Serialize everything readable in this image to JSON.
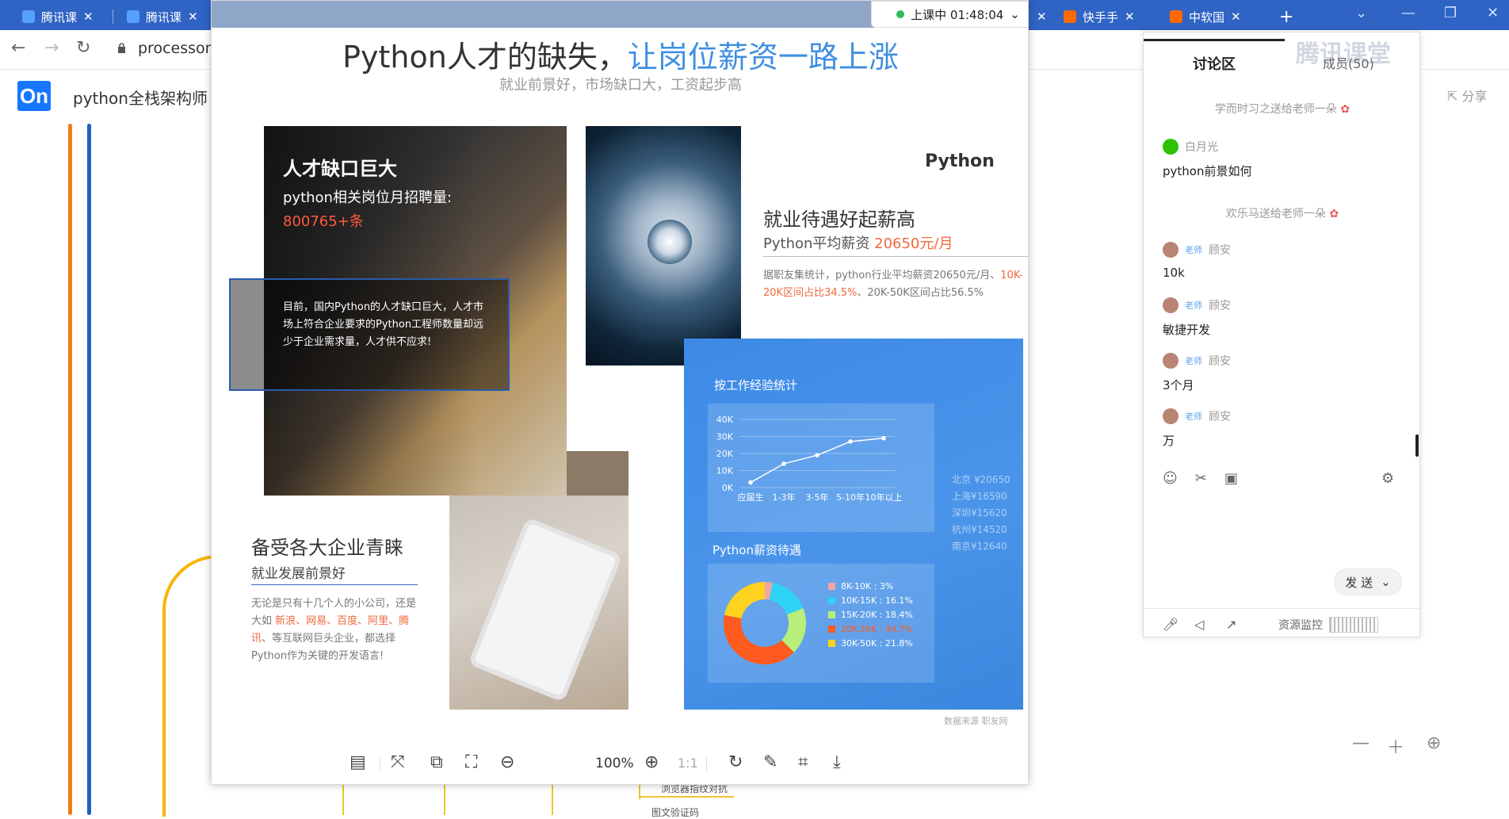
{
  "browser": {
    "tabs": [
      {
        "label": "腾讯课",
        "color": "#2f63c4"
      },
      {
        "label": "腾讯课",
        "color": "#2f63c4"
      },
      {
        "label": "快手手",
        "color": "#ff6a00"
      },
      {
        "label": "中软国",
        "color": "#ff6a00"
      }
    ],
    "url": "processon.",
    "new_tab": "+"
  },
  "app": {
    "logo": "On",
    "title": "python全栈架构师",
    "share": "分享"
  },
  "mindmap": {
    "nodes": [
      "浏览器指纹对抗",
      "图文验证码"
    ]
  },
  "viewer": {
    "timer": "上课中 01:48:04",
    "zoom": "100%"
  },
  "slide": {
    "title_a": "Python人才的缺失，",
    "title_b": "让岗位薪资一路上涨",
    "subtitle": "就业前景好，市场缺口大，工资起步高",
    "gap": {
      "heading": "人才缺口巨大",
      "line": "python相关岗位月招聘量:",
      "number": "800765+条",
      "callout": "目前，国内Python的人才缺口巨大，人才市场上符合企业要求的Python工程师数量却远少于企业需求量，人才供不应求!"
    },
    "job": {
      "python_label": "Python",
      "heading": "就业待遇好起薪高",
      "salary_prefix": "Python平均薪资 ",
      "salary_value": "20650元/月",
      "para_a": "据职友集统计，python行业平均薪资20650元/月、",
      "para_hl": "10K-20K区间占比34.5%",
      "para_b": "、20K-50K区间占比56.5%"
    },
    "panel": {
      "line_title": "按工作经验统计",
      "donut_title": "Python薪资待遇",
      "cities": [
        "北京 ¥20650",
        "上海¥16590",
        "深圳¥15620",
        "杭州¥14520",
        "南京¥12640"
      ],
      "source": "数据来源 职友网"
    },
    "enterprise": {
      "heading": "备受各大企业青睐",
      "sub": "就业发展前景好",
      "para_a": "无论是只有十几个人的小公司，还是大如 ",
      "para_hl": "新浪、网易、百度、阿里、腾讯",
      "para_b": "、等互联网巨头企业，都选择Python作为关键的开发语言!"
    }
  },
  "chart_data": [
    {
      "type": "line",
      "title": "按工作经验统计",
      "categories": [
        "应届生",
        "1-3年",
        "3-5年",
        "5-10年",
        "10年以上"
      ],
      "yticks": [
        "0K",
        "10K",
        "20K",
        "30K",
        "40K"
      ],
      "values": [
        3,
        14,
        19,
        27,
        29
      ],
      "ylim": [
        0,
        40
      ],
      "grid": true,
      "color": "#ffffff"
    },
    {
      "type": "pie",
      "title": "Python薪资待遇",
      "labels": [
        "8K-10K : 3%",
        "10K-15K : 16.1%",
        "15K-20K : 18.4%",
        "20K-30K : 40.7%",
        "30K-50K : 21.8%"
      ],
      "values": [
        3,
        16.1,
        18.4,
        40.7,
        21.8
      ],
      "colors": [
        "#f4a3a3",
        "#2fd3f5",
        "#b7ef7a",
        "#ff5a1f",
        "#ffd21f"
      ],
      "legend": "right"
    }
  ],
  "discussion": {
    "title": "讨论区",
    "members": "成员(50)",
    "brand": "腾讯课堂",
    "messages": [
      {
        "kind": "system",
        "text": "学而时习之送给老师一朵"
      },
      {
        "kind": "user",
        "user": "白月光",
        "role": "",
        "text": "python前景如何"
      },
      {
        "kind": "system",
        "text": "欢乐马送给老师一朵"
      },
      {
        "kind": "user",
        "user": "顾安",
        "role": "老师",
        "text": "10k"
      },
      {
        "kind": "user",
        "user": "顾安",
        "role": "老师",
        "text": "敏捷开发"
      },
      {
        "kind": "user",
        "user": "顾安",
        "role": "老师",
        "text": "3个月"
      },
      {
        "kind": "user",
        "user": "顾安",
        "role": "老师",
        "text": "万"
      }
    ],
    "send": "发 送",
    "resource": "资源监控"
  },
  "colors": {
    "accent": "#3f8fe0",
    "highlight": "#ee6a3c",
    "tabbar": "#2f63c4"
  }
}
